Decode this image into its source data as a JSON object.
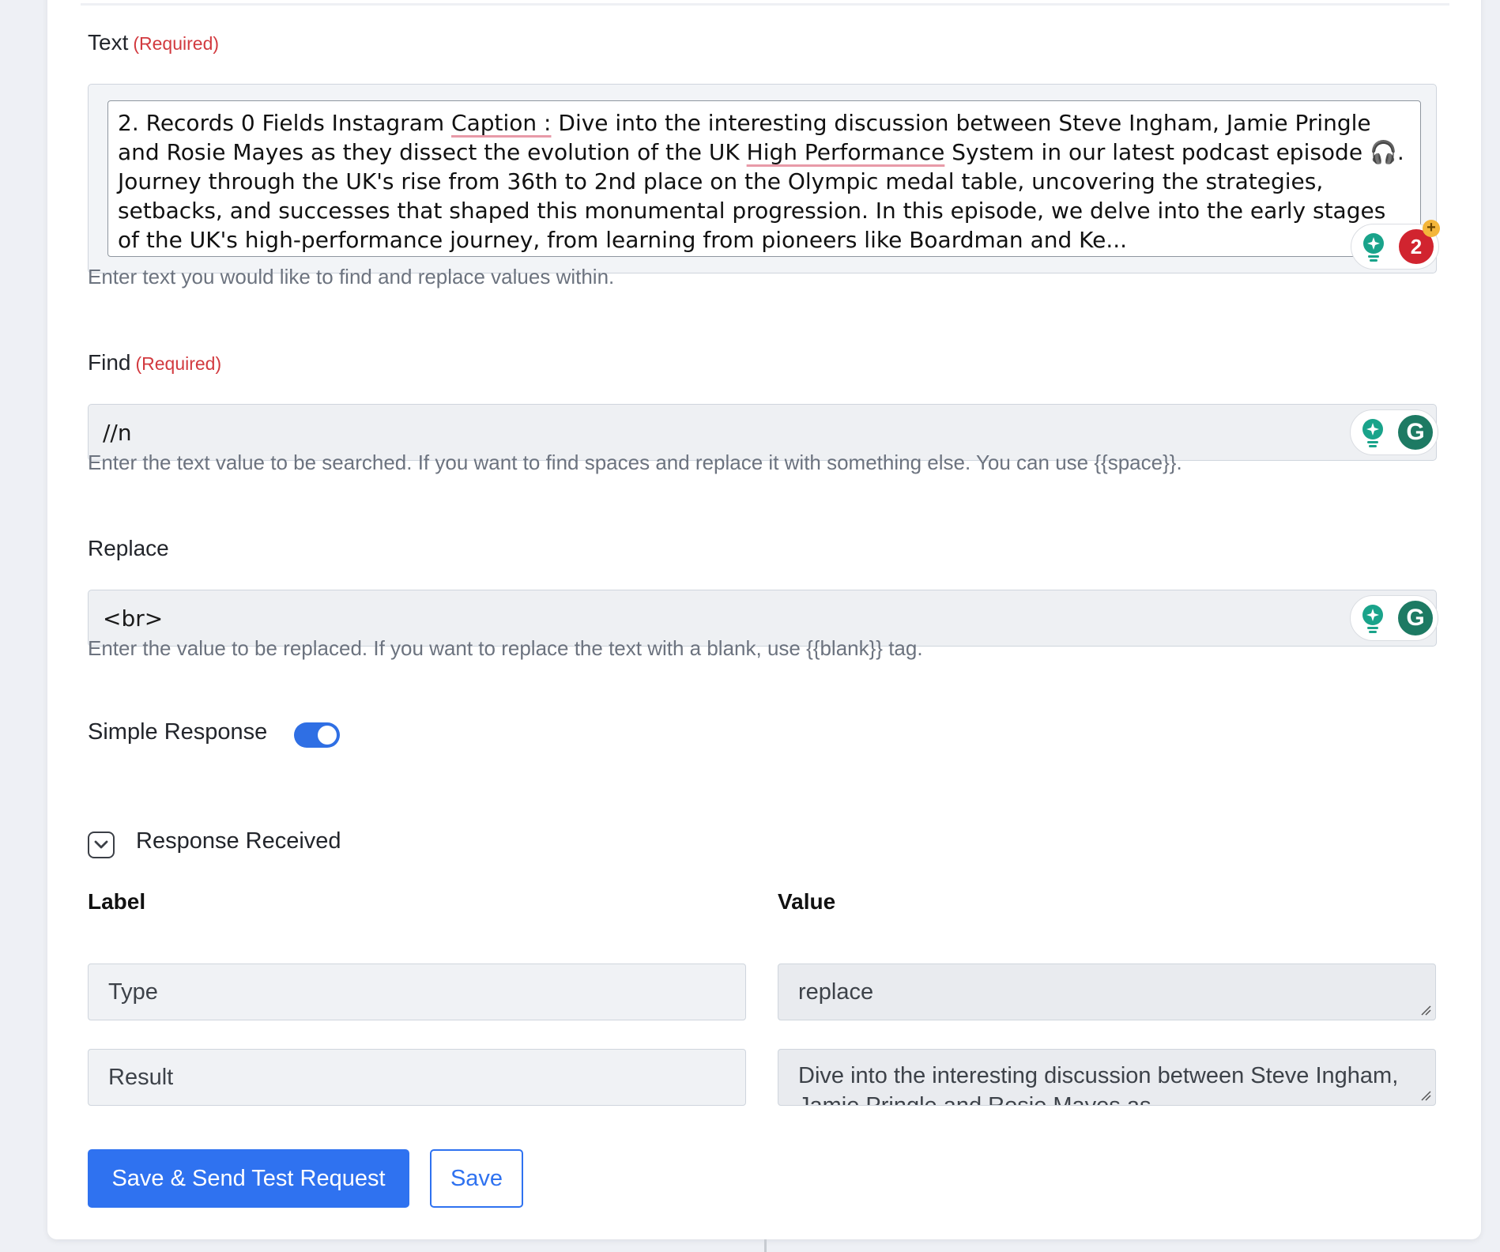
{
  "text_field": {
    "label": "Text",
    "required": "(Required)",
    "value": {
      "p1": "2. Records 0 Fields Instagram ",
      "u1": "Caption :",
      "p2": " Dive into the interesting discussion between Steve Ingham, Jamie Pringle and Rosie Mayes as they dissect the evolution of the UK ",
      "u2": "High Performance",
      "p3": " System in our latest podcast episode 🎧. Journey through the UK's rise from 36th to 2nd place on the Olympic medal table, uncovering the strategies, setbacks, and successes that shaped this monumental progression. In this episode, we delve into the early stages of the UK's high-performance journey, from learning from pioneers like Boardman and Ke..."
    },
    "help": "Enter text you would like to find and replace values within.",
    "grammarly_badge_count": "2",
    "grammarly_plus": "+"
  },
  "find_field": {
    "label": "Find",
    "required": "(Required)",
    "value": "//n",
    "help": "Enter the text value to be searched. If you want to find spaces and replace it with something else. You can use {{space}}."
  },
  "replace_field": {
    "label": "Replace",
    "value": "<br>",
    "help": "Enter the value to be replaced. If you want to replace the text with a blank, use {{blank}} tag."
  },
  "grammarly_letter": "G",
  "simple_response": {
    "label": "Simple Response",
    "enabled": true
  },
  "response_section": {
    "title": "Response Received",
    "label_header": "Label",
    "value_header": "Value",
    "rows": [
      {
        "label": "Type",
        "value": "replace"
      },
      {
        "label": "Result",
        "value": "Dive into the interesting discussion between Steve Ingham, Jamie Pringle and Rosie Mayes as..."
      }
    ]
  },
  "buttons": {
    "save_send": "Save & Send Test Request",
    "save": "Save"
  },
  "colors": {
    "primary": "#2f72f0",
    "required": "#d23a3f",
    "grammarly_green": "#1d7a63",
    "badge_red": "#d1242f"
  }
}
